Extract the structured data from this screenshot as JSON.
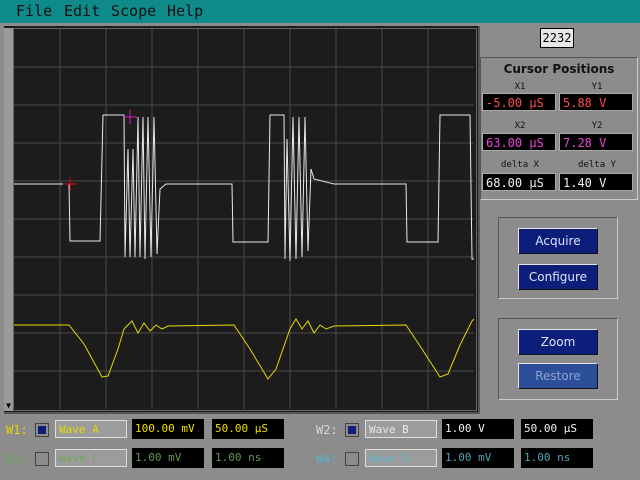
{
  "menu": [
    "File",
    "Edit",
    "Scope",
    "Help"
  ],
  "counter": "2232",
  "cursor": {
    "title": "Cursor Positions",
    "x1": {
      "label": "X1",
      "value": "-5.00 µS"
    },
    "y1": {
      "label": "Y1",
      "value": "5.88 V"
    },
    "x2": {
      "label": "X2",
      "value": "63.00 µS"
    },
    "y2": {
      "label": "Y2",
      "value": "7.28 V"
    },
    "dx": {
      "label": "delta X",
      "value": "68.00 µS"
    },
    "dy": {
      "label": "delta Y",
      "value": "1.40 V"
    }
  },
  "buttons": {
    "acquire": "Acquire",
    "configure": "Configure",
    "zoom": "Zoom",
    "restore": "Restore"
  },
  "waves": {
    "w1": {
      "label": "W1:",
      "name": "Wave A",
      "volts": "100.00 mV",
      "time": "50.00 µS",
      "enabled": true,
      "color": "#e6d800"
    },
    "w2": {
      "label": "W2:",
      "name": "Wave B",
      "volts": "1.00 V",
      "time": "50.00 µS",
      "enabled": true,
      "color": "#ffffff"
    },
    "w3": {
      "label": "W3:",
      "name": "Wave C",
      "volts": "1.00 mV",
      "time": "1.00 ns",
      "enabled": false,
      "color": "#6fa85a"
    },
    "w4": {
      "label": "W4:",
      "name": "Wave D",
      "volts": "1.00 mV",
      "time": "1.00 ns",
      "enabled": false,
      "color": "#5ab3c8"
    }
  },
  "colors": {
    "menubar": "#0f8a8a",
    "button": "#0c1e7a",
    "trace_digital": "#e8e8e8",
    "trace_analog": "#e6d800",
    "cursor1": "#d01010",
    "cursor2": "#d020c0"
  }
}
